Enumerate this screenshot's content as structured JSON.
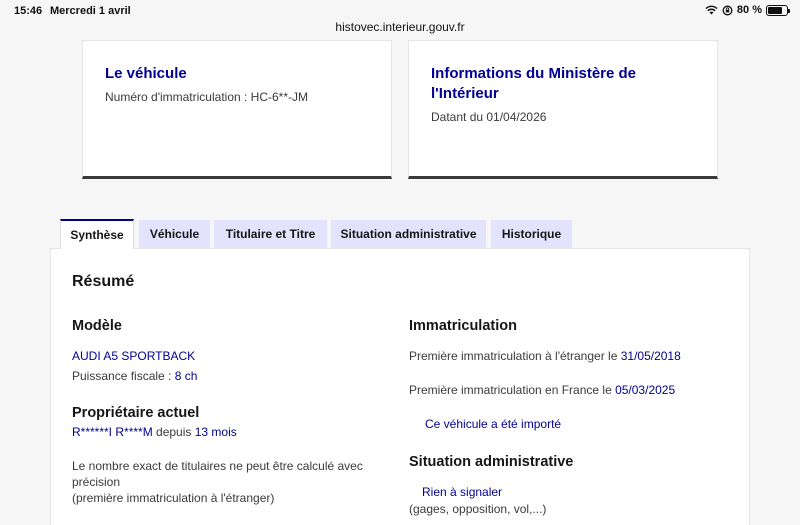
{
  "status_bar": {
    "time": "15:46",
    "date": "Mercredi 1 avril",
    "battery": "80 %",
    "battery_level": 0.8
  },
  "browser": {
    "url": "histovec.interieur.gouv.fr"
  },
  "cards": {
    "vehicle": {
      "title": "Le véhicule",
      "text": "Numéro d'immatriculation : HC-6**-JM"
    },
    "ministry": {
      "title_line1": "Informations du Ministère de",
      "title_line2": "l'Intérieur",
      "text": "Datant du 01/04/2026"
    }
  },
  "tabs": [
    {
      "label": "Synthèse",
      "active": true
    },
    {
      "label": "Véhicule",
      "active": false
    },
    {
      "label": "Titulaire et Titre",
      "active": false
    },
    {
      "label": "Situation administrative",
      "active": false
    },
    {
      "label": "Historique",
      "active": false
    }
  ],
  "summary": {
    "title": "Résumé",
    "model": {
      "heading": "Modèle",
      "name": "AUDI A5 SPORTBACK",
      "power_label": "Puissance fiscale : ",
      "power_value": "8 ch"
    },
    "owner": {
      "heading": "Propriétaire actuel",
      "name": "R******I R****M",
      "since_label": " depuis ",
      "since_value": "13 mois",
      "note_line1": "Le nombre exact de titulaires ne peut être calculé avec",
      "note_line2": "précision",
      "note_line3": "(première immatriculation à l'étranger)"
    },
    "registration": {
      "heading": "Immatriculation",
      "foreign_label": "Première immatriculation à l'étranger le ",
      "foreign_date": "31/05/2018",
      "france_label": "Première immatriculation en France le ",
      "france_date": "05/03/2025",
      "imported": "Ce véhicule a été importé"
    },
    "admin": {
      "heading": "Situation administrative",
      "status": "Rien à signaler",
      "detail": "(gages, opposition, vol,...)"
    }
  }
}
